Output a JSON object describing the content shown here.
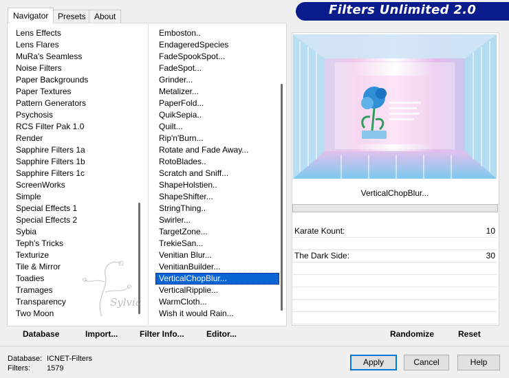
{
  "tabs": [
    {
      "label": "Navigator",
      "active": true
    },
    {
      "label": "Presets",
      "active": false
    },
    {
      "label": "About",
      "active": false
    }
  ],
  "banner_title": "Filters Unlimited 2.0",
  "categories": [
    "Lens Effects",
    "Lens Flares",
    "MuRa's Seamless",
    "Noise Filters",
    "Paper Backgrounds",
    "Paper Textures",
    "Pattern Generators",
    "Psychosis",
    "RCS Filter Pak 1.0",
    "Render",
    "Sapphire Filters 1a",
    "Sapphire Filters 1b",
    "Sapphire Filters 1c",
    "ScreenWorks",
    "Simple",
    "Special Effects 1",
    "Special Effects 2",
    "Sybia",
    "Teph's Tricks",
    "Texturize",
    "Tile & Mirror",
    "Toadies",
    "Tramages",
    "Transparency",
    "Two Moon"
  ],
  "filters": [
    "Emboston..",
    "EndageredSpecies",
    "FadeSpookSpot...",
    "FadeSpot...",
    "Grinder...",
    "Metalizer...",
    "PaperFold...",
    "QuikSepia..",
    "Quilt...",
    "Rip'n'Burn...",
    "Rotate and Fade Away...",
    "RotoBlades..",
    "Scratch and Sniff...",
    "ShapeHolstien..",
    "ShapeShifter...",
    "StringThing..",
    "Swirler...",
    "TargetZone...",
    "TrekieSan...",
    "Venitian Blur...",
    "VenitianBuilder...",
    "VerticalChopBlur...",
    "VerticalRipplie...",
    "WarmCloth...",
    "Wish it would Rain..."
  ],
  "selected_filter_index": 21,
  "bottom_buttons": {
    "database": "Database",
    "import": "Import...",
    "filter_info": "Filter Info...",
    "editor": "Editor..."
  },
  "selected_filter_name": "VerticalChopBlur...",
  "parameters": [
    {
      "label": "Karate Kount:",
      "value": "10"
    },
    {
      "label": "The Dark Side:",
      "value": "30"
    }
  ],
  "right_buttons": {
    "randomize": "Randomize",
    "reset": "Reset"
  },
  "status": {
    "database_label": "Database:",
    "database_value": "ICNET-Filters",
    "filters_label": "Filters:",
    "filters_value": "1579"
  },
  "dialog_buttons": {
    "apply": "Apply",
    "cancel": "Cancel",
    "help": "Help"
  },
  "watermark_text": "Sylvia",
  "colors": {
    "banner": "#0a1c8c",
    "selection": "#0a64d2",
    "focus_border": "#0078d7"
  }
}
